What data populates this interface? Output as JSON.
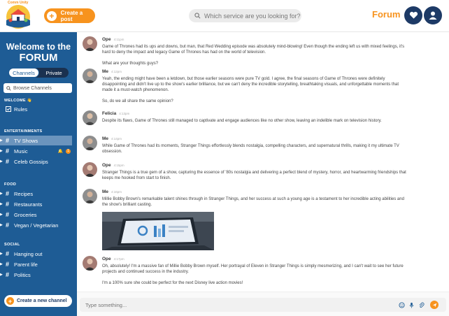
{
  "header": {
    "logo_text": "Comm Unity",
    "create_post_label": "Create a post",
    "search_placeholder": "Which service are you looking for?",
    "forum_label": "Forum"
  },
  "sidebar": {
    "welcome_line1": "Welcome to the",
    "welcome_line2": "FORUM",
    "tabs": [
      {
        "label": "Channels",
        "active": true
      },
      {
        "label": "Private",
        "active": false
      }
    ],
    "browse_label": "Browse Channels",
    "sections": [
      {
        "title": "WELCOME 👋",
        "items": [
          {
            "label": "Rules",
            "icon": "checkbox-icon"
          }
        ]
      },
      {
        "title": "ENTERTAINMENTS",
        "items": [
          {
            "label": "TV Shows",
            "active": true
          },
          {
            "label": "Music",
            "badge": "1"
          },
          {
            "label": "Celeb Gossips"
          }
        ]
      },
      {
        "title": "FOOD",
        "items": [
          {
            "label": "Recipes"
          },
          {
            "label": "Restaurants"
          },
          {
            "label": "Groceries"
          },
          {
            "label": "Vegan / Vegetarian"
          }
        ]
      },
      {
        "title": "SOCIAL",
        "items": [
          {
            "label": "Hanging out"
          },
          {
            "label": "Parent life"
          },
          {
            "label": "Politics"
          }
        ]
      }
    ],
    "new_channel_label": "Create a new channel"
  },
  "messages": [
    {
      "author": "Ope",
      "time": "4:11pm",
      "paragraphs": [
        "Game of Thrones had its ups and downs, but man, that Red Wedding episode was absolutely mind-blowing! Even though the ending left us with mixed feelings, it's hard to deny the impact and legacy Game of Thrones has had on the world of television.",
        "What are your thoughts guys?"
      ]
    },
    {
      "author": "Me",
      "time": "4:12pm",
      "paragraphs": [
        "Yeah, the ending might have been a letdown, but those earlier seasons were pure TV gold. I agree, the final seasons of Game of Thrones were definitely disappointing and didn't live up to the show's earlier brilliance, but we can't deny the incredible storytelling, breathtaking visuals, and unforgettable moments that made it a must-watch phenomenon.",
        "So, do we all share the same opinion?"
      ]
    },
    {
      "author": "Felicia",
      "time": "4:13pm",
      "paragraphs": [
        "Despite its flaws, Game of Thrones still managed to captivate and engage audiences like no other show, leaving an indelible mark on television history."
      ]
    },
    {
      "author": "Me",
      "time": "4:14pm",
      "paragraphs": [
        "While Game of Thrones had its moments, Stranger Things effortlessly blends nostalgia, compelling characters, and supernatural thrills, making it my ultimate TV obsession."
      ]
    },
    {
      "author": "Ope",
      "time": "4:15pm",
      "paragraphs": [
        "Stranger Things is a true gem of a show, capturing the essence of '80s nostalgia and delivering a perfect blend of mystery, horror, and heartwarming friendships that keeps me hooked from start to finish."
      ]
    },
    {
      "author": "Me",
      "time": "4:16pm",
      "paragraphs": [
        "Millie Bobby Brown's remarkable talent shines through in Stranger Things, and her success at such a young age is a testament to her incredible acting abilities and the show's brilliant casting."
      ],
      "has_image": true
    },
    {
      "author": "Ope",
      "time": "4:17pm",
      "paragraphs": [
        "Oh, absolutely! I'm a massive fan of Millie Bobby Brown myself. Her portrayal of Eleven in Stranger Things is simply mesmerizing, and I can't wait to see her future projects and continued success in the industry.",
        "I'm a 100% sure she could be perfect for the next Disney live action movies!"
      ]
    }
  ],
  "composer": {
    "placeholder": "Type something..."
  }
}
